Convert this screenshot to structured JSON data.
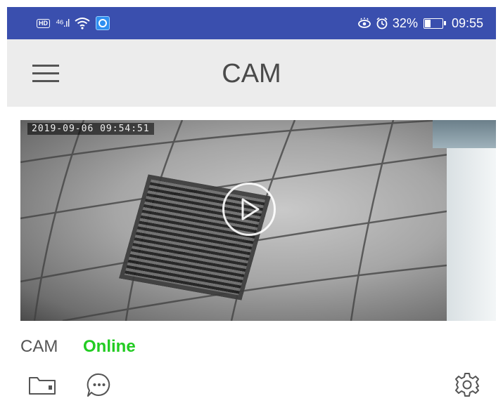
{
  "status_bar": {
    "hd_label": "HD",
    "signal_label": "⁴⁶.ıl",
    "battery_text": "32%",
    "battery_level": 0.32,
    "time": "09:55",
    "icons": [
      "hd-icon",
      "signal-icon",
      "wifi-icon",
      "app-notification-icon",
      "eye-icon",
      "alarm-icon",
      "battery-icon"
    ],
    "background_color": "#3a4fae"
  },
  "app_bar": {
    "title": "CAM",
    "menu_icon": "hamburger-menu-icon"
  },
  "preview": {
    "timestamp": "2019-09-06 09:54:51",
    "play_icon": "play-icon"
  },
  "device": {
    "name": "CAM",
    "status": "Online",
    "status_color": "#22cc22"
  },
  "actions": {
    "icons": [
      "folder-icon",
      "message-icon",
      "settings-icon"
    ]
  }
}
